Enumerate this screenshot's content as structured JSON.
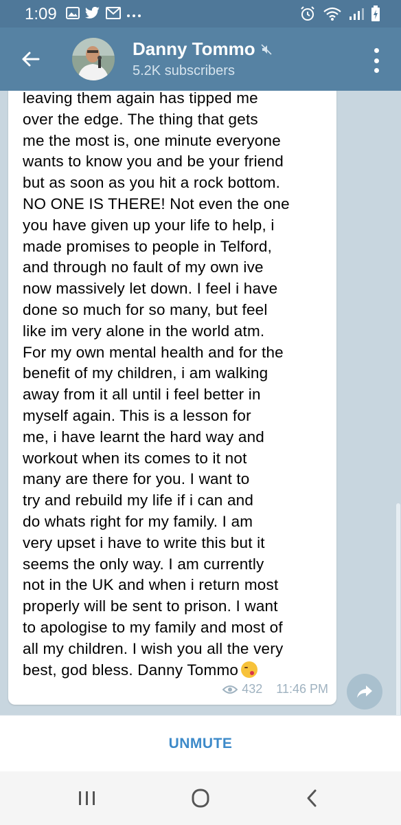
{
  "status_bar": {
    "time": "1:09",
    "left_icons": [
      "gallery-icon",
      "twitter-icon",
      "gmail-icon",
      "more-dots-icon"
    ],
    "right_icons": [
      "alarm-icon",
      "wifi-icon",
      "signal-icon",
      "battery-icon"
    ]
  },
  "header": {
    "title": "Danny Tommo",
    "subtitle": "5.2K subscribers",
    "muted": true
  },
  "message": {
    "text": "leaving them again has tipped me\nover the edge. The thing that gets\nme the most is, one minute everyone\nwants to know you and be your friend\nbut as soon as you hit a rock bottom.\nNO ONE IS THERE! Not even the one\nyou have given up your life to help, i\nmade promises to people in Telford,\nand through no fault of my own ive\nnow massively let down. I feel i have\ndone so much for so many, but feel\nlike im very alone in the world atm.\nFor my own mental health and for the\nbenefit of my children, i am walking\naway from it all until i feel better in\nmyself again. This is a lesson for\nme, i have learnt the hard way and\nworkout when its comes to it not\nmany are there for you. I want to\ntry and rebuild my life if i can and\ndo whats right for my family. I am\nvery upset i have to write this but it\nseems the only way. I am currently\nnot in the UK and when i return most\nproperly will be sent to prison. I want\nto apologise to my family and most of\nall my children. I wish you all the very\nbest, god bless. Danny Tommo",
    "emoji": "kissing-face-emoji",
    "views": "432",
    "time": "11:46 PM"
  },
  "bottom": {
    "unmute_label": "UNMUTE"
  },
  "colors": {
    "status_bar": "#4f7899",
    "app_bar": "#5682a3",
    "chat_bg": "#c8d6df",
    "accent": "#3d8ac9"
  }
}
